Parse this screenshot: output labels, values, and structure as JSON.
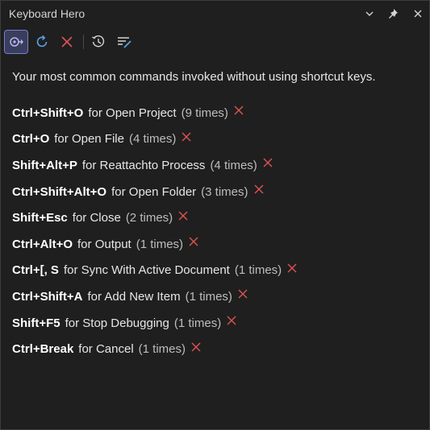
{
  "window": {
    "title": "Keyboard Hero"
  },
  "titlebar_buttons": [
    {
      "name": "chevron-down-icon"
    },
    {
      "name": "pin-icon"
    },
    {
      "name": "close-icon"
    }
  ],
  "toolbar": [
    {
      "name": "settings-toggle-icon",
      "active": true
    },
    {
      "name": "refresh-icon",
      "active": false
    },
    {
      "name": "clear-all-icon",
      "active": false
    },
    {
      "name": "history-icon",
      "active": false
    },
    {
      "name": "filter-list-icon",
      "active": false
    }
  ],
  "intro": "Your most common commands invoked without using shortcut keys.",
  "commands": [
    {
      "keys": "Ctrl+Shift+O",
      "command": "for Open Project",
      "count": "(9 times)"
    },
    {
      "keys": "Ctrl+O",
      "command": "for Open File",
      "count": "(4 times)"
    },
    {
      "keys": "Shift+Alt+P",
      "command": "for Reattachto Process",
      "count": "(4 times)"
    },
    {
      "keys": "Ctrl+Shift+Alt+O",
      "command": "for Open Folder",
      "count": "(3 times)"
    },
    {
      "keys": "Shift+Esc",
      "command": "for Close",
      "count": "(2 times)"
    },
    {
      "keys": "Ctrl+Alt+O",
      "command": "for Output",
      "count": "(1 times)"
    },
    {
      "keys": "Ctrl+[, S",
      "command": "for Sync With Active Document",
      "count": "(1 times)"
    },
    {
      "keys": "Ctrl+Shift+A",
      "command": "for Add New Item",
      "count": "(1 times)"
    },
    {
      "keys": "Shift+F5",
      "command": "for Stop Debugging",
      "count": "(1 times)"
    },
    {
      "keys": "Ctrl+Break",
      "command": "for Cancel",
      "count": "(1 times)"
    }
  ],
  "colors": {
    "background": "#1f1f1f",
    "accent": "#7a7fd6",
    "remove": "#e05252",
    "refresh": "#5aa0e6"
  }
}
